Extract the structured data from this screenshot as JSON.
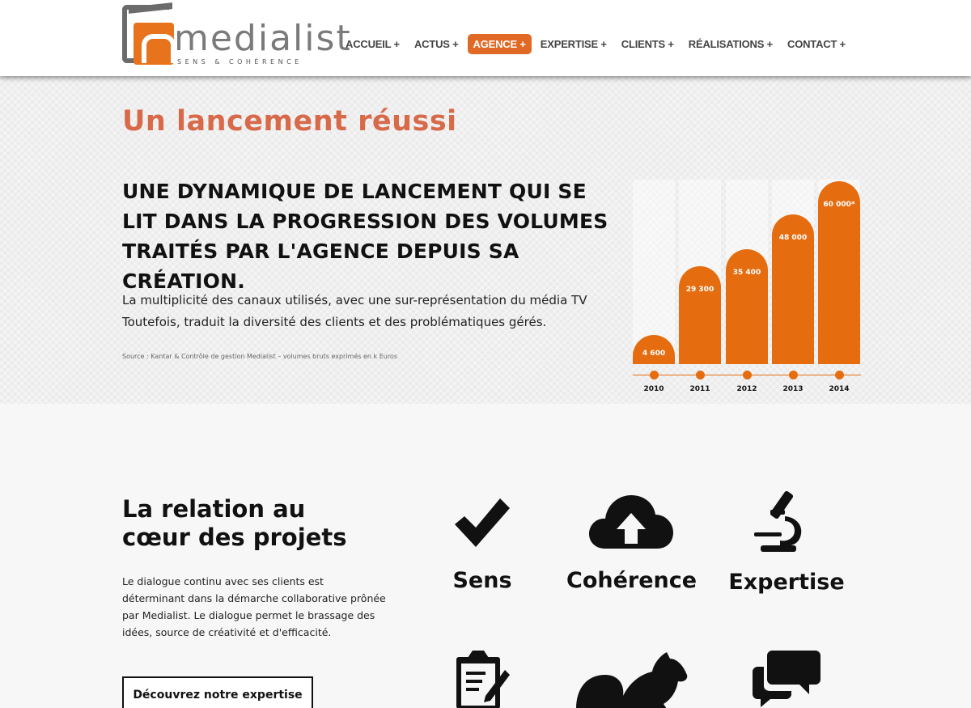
{
  "brand": {
    "name": "medialist",
    "tagline": "SENS & COHÉRENCE"
  },
  "nav": [
    {
      "label": "ACCUEIL +",
      "active": false
    },
    {
      "label": "ACTUS +",
      "active": false
    },
    {
      "label": "AGENCE +",
      "active": true
    },
    {
      "label": "EXPERTISE +",
      "active": false
    },
    {
      "label": "CLIENTS +",
      "active": false
    },
    {
      "label": "RÉALISATIONS +",
      "active": false
    },
    {
      "label": "CONTACT +",
      "active": false
    }
  ],
  "hero": {
    "title": "Un lancement réussi",
    "heading": "UNE DYNAMIQUE DE LANCEMENT QUI SE LIT DANS LA PROGRESSION DES VOLUMES TRAITÉS PAR L'AGENCE DEPUIS SA CRÉATION.",
    "paragraph": "La multiplicité des canaux utilisés, avec une sur-représentation du média TV Toutefois, traduit la diversité des clients et des problématiques gérés.",
    "source": "Source : Kantar & Contrôle de gestion Medialist – volumes bruts exprimés en k Euros"
  },
  "chart_data": {
    "type": "bar",
    "categories": [
      "2010",
      "2011",
      "2012",
      "2013",
      "2014"
    ],
    "values": [
      4600,
      29300,
      35400,
      48000,
      60000
    ],
    "value_labels": [
      "4 600",
      "29 300",
      "35 400",
      "48 000",
      "60 000*"
    ],
    "ylim": [
      0,
      60000
    ],
    "color": "#e56d10"
  },
  "relation": {
    "title_line1": "La relation au",
    "title_line2": "cœur des projets",
    "paragraph": "Le dialogue continu avec ses clients est déterminant dans la démarche collaborative prônée par Medialist. Le dialogue permet le brassage des idées, source de créativité et d'efficacité.",
    "cta": "Découvrez notre expertise"
  },
  "features": [
    {
      "label": "Sens",
      "icon": "checkmark-icon"
    },
    {
      "label": "Cohérence",
      "icon": "cloud-upload-icon"
    },
    {
      "label": "Expertise",
      "icon": "microscope-icon"
    },
    {
      "label": "",
      "icon": "clipboard-icon"
    },
    {
      "label": "",
      "icon": "squirrel-icon"
    },
    {
      "label": "",
      "icon": "chat-bubbles-icon"
    }
  ]
}
